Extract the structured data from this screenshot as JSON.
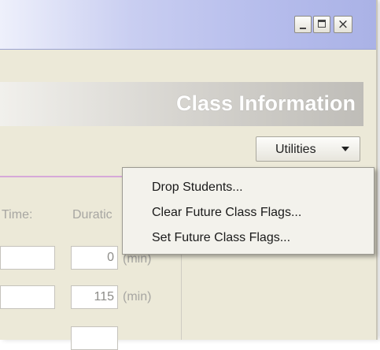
{
  "window": {
    "controls": {
      "minimize": "_",
      "maximize": "□",
      "close": "×"
    }
  },
  "header": {
    "title": "Class Information"
  },
  "utilities": {
    "label": "Utilities"
  },
  "form": {
    "time_label": "Time:",
    "duration_label": "Duratic",
    "rows": [
      {
        "duration_value": "0",
        "unit": "(min)"
      },
      {
        "duration_value": "115",
        "unit": "(min)"
      }
    ]
  },
  "menu": {
    "items": [
      {
        "label": "Drop Students..."
      },
      {
        "label": "Clear Future Class Flags..."
      },
      {
        "label": "Set Future Class Flags..."
      }
    ]
  }
}
